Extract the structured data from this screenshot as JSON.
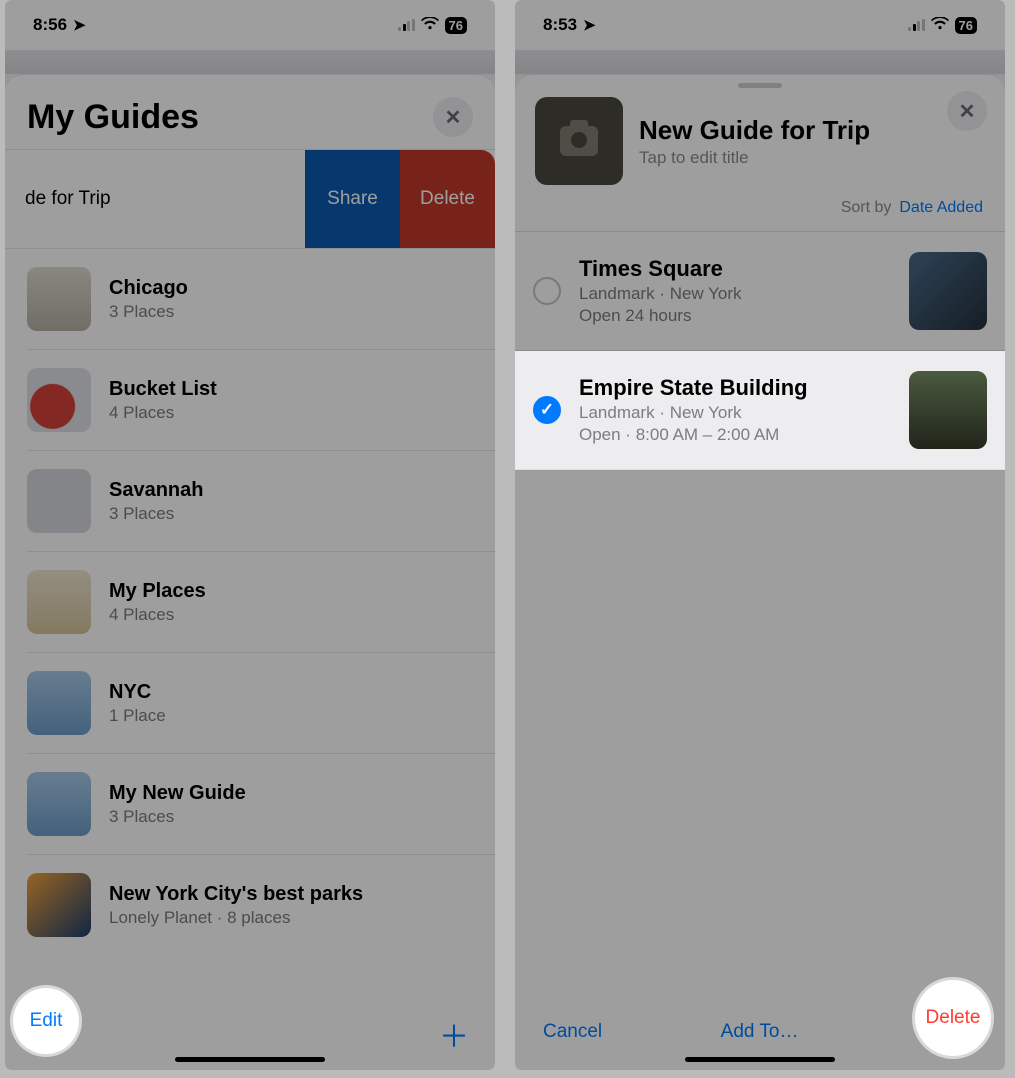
{
  "left": {
    "status": {
      "time": "8:56",
      "battery": "76"
    },
    "sheet_title": "My Guides",
    "swipe": {
      "partial_title": "de for Trip",
      "share_label": "Share",
      "delete_label": "Delete"
    },
    "guides": [
      {
        "title": "Chicago",
        "sub": "3 Places"
      },
      {
        "title": "Bucket List",
        "sub": "4 Places"
      },
      {
        "title": "Savannah",
        "sub": "3 Places"
      },
      {
        "title": "My Places",
        "sub": "4 Places"
      },
      {
        "title": "NYC",
        "sub": "1 Place"
      },
      {
        "title": "My New Guide",
        "sub": "3 Places"
      },
      {
        "title": "New York City's best parks",
        "sub": "Lonely Planet · 8 places"
      }
    ],
    "edit_label": "Edit"
  },
  "right": {
    "status": {
      "time": "8:53",
      "battery": "76"
    },
    "header": {
      "title": "New Guide for Trip",
      "subtitle": "Tap to edit title"
    },
    "sort": {
      "label": "Sort by",
      "value": "Date Added"
    },
    "places": [
      {
        "title": "Times Square",
        "sub": "Landmark · New York",
        "open": "Open 24 hours",
        "checked": false
      },
      {
        "title": "Empire State Building",
        "sub": "Landmark · New York",
        "open": "Open · 8:00 AM – 2:00 AM",
        "checked": true
      }
    ],
    "toolbar": {
      "cancel": "Cancel",
      "addto": "Add To…",
      "delete": "Delete"
    }
  }
}
